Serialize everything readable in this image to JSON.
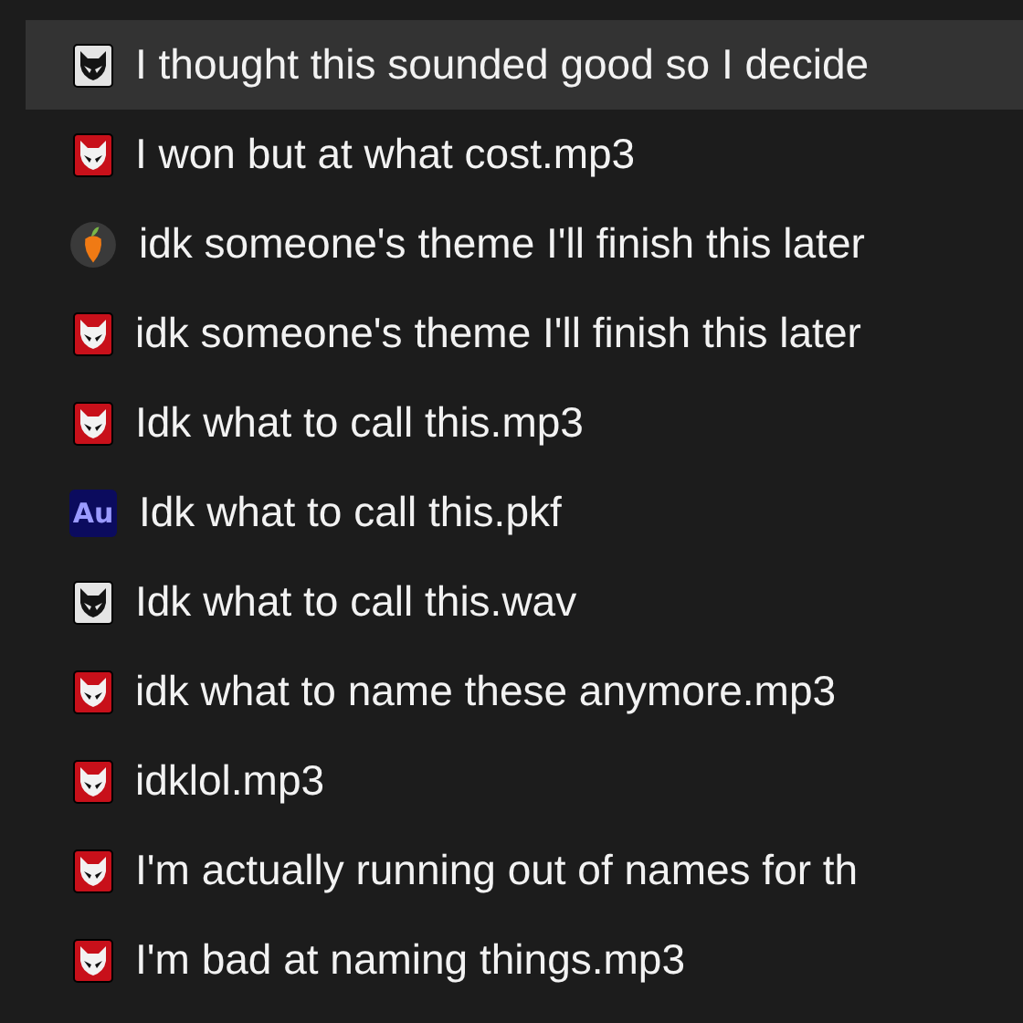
{
  "files": [
    {
      "name": "I thought this sounded good so I decide",
      "kind": "fox-light",
      "selected": true
    },
    {
      "name": "I won but at what cost.mp3",
      "kind": "fox-red",
      "selected": false
    },
    {
      "name": "idk someone's theme I'll finish this later",
      "kind": "fruit",
      "selected": false
    },
    {
      "name": "idk someone's theme I'll finish this later",
      "kind": "fox-red",
      "selected": false
    },
    {
      "name": "Idk what to call this.mp3",
      "kind": "fox-red",
      "selected": false
    },
    {
      "name": "Idk what to call this.pkf",
      "kind": "au",
      "icon_text": "Au",
      "selected": false
    },
    {
      "name": "Idk what to call this.wav",
      "kind": "fox-light",
      "selected": false
    },
    {
      "name": "idk what to name these anymore.mp3",
      "kind": "fox-red",
      "selected": false
    },
    {
      "name": "idklol.mp3",
      "kind": "fox-red",
      "selected": false
    },
    {
      "name": "I'm actually running out of names for th",
      "kind": "fox-red",
      "selected": false
    },
    {
      "name": "I'm bad at naming things.mp3",
      "kind": "fox-red",
      "selected": false
    }
  ]
}
